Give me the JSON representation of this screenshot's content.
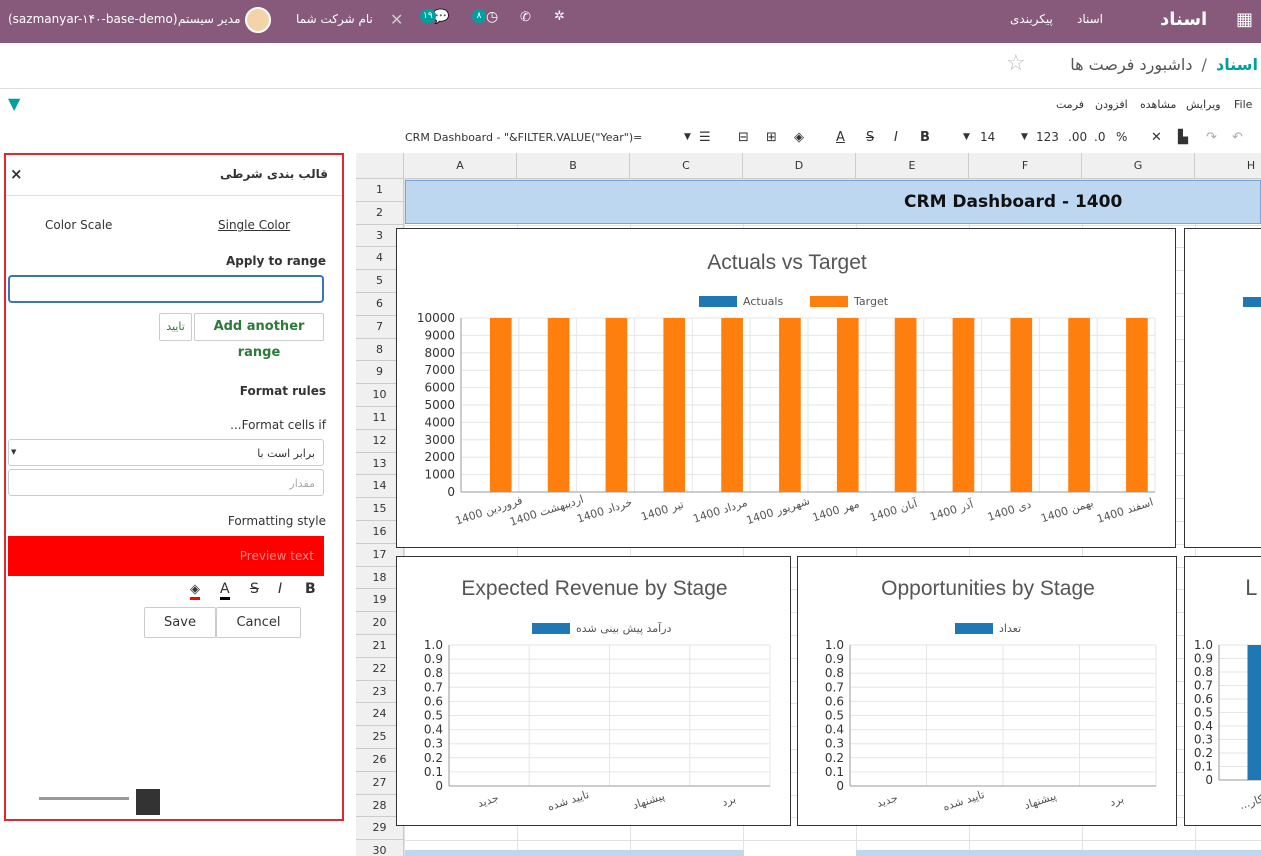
{
  "topbar": {
    "app_name": "اسناد",
    "menu": [
      "اسناد",
      "پیکربندی"
    ],
    "user": "مدیر سیستم",
    "db": "(sazmanyar-۱۴۰-base-demo)",
    "company": "نام شرکت شما",
    "badge_messages": "۱۹",
    "badge_activities": "۸"
  },
  "breadcrumb": {
    "root": "اسناد",
    "separator": "/",
    "current": "داشبورد فرصت ها"
  },
  "menubar": {
    "file": "File",
    "edit": "ویرایش",
    "view": "مشاهده",
    "insert": "افزودن",
    "format": "فرمت"
  },
  "toolbar": {
    "formula": "CRM Dashboard - \"&FILTER.VALUE(\"Year\")=",
    "font_size": "14",
    "num_format": "123",
    "dec_more": ".00",
    "dec_less": ".0",
    "percent": "%"
  },
  "panel": {
    "title": "قالب بندی شرطی",
    "close": "×",
    "tab_single": "Single Color",
    "tab_scale": "Color Scale",
    "apply_range_label": "Apply to range",
    "range_value": "",
    "add_range": "Add another range",
    "confirm": "تایید",
    "format_rules": "Format rules",
    "format_cells_if": "...Format cells if",
    "condition_value": "برابر است با",
    "value_placeholder": "مقدار",
    "formatting_style": "Formatting style",
    "preview_text": "Preview text",
    "save": "Save",
    "cancel": "Cancel",
    "preview_color": "#ff0000"
  },
  "sheet": {
    "columns": [
      "A",
      "B",
      "C",
      "D",
      "E",
      "F",
      "G",
      "H"
    ],
    "rows": [
      "1",
      "2",
      "3",
      "4",
      "5",
      "6",
      "7",
      "8",
      "9",
      "10",
      "11",
      "12",
      "13",
      "14",
      "15",
      "16",
      "17",
      "18",
      "19",
      "20",
      "21",
      "22",
      "23",
      "24",
      "25",
      "26",
      "27",
      "28",
      "29",
      "30"
    ],
    "banner_title": "CRM Dashboard - 1400",
    "banner_color": "#bdd7f1"
  },
  "chart_data": [
    {
      "type": "bar",
      "title": "Actuals vs Target",
      "categories": [
        "فروردین 1400",
        "اردیبهشت 1400",
        "خرداد 1400",
        "تیر 1400",
        "مرداد 1400",
        "شهریور 1400",
        "مهر 1400",
        "آبان 1400",
        "آذر 1400",
        "دی 1400",
        "بهمن 1400",
        "اسفند 1400"
      ],
      "series": [
        {
          "name": "Actuals",
          "color": "#1f77b4",
          "values": [
            0,
            0,
            0,
            0,
            0,
            0,
            0,
            0,
            0,
            0,
            0,
            0
          ]
        },
        {
          "name": "Target",
          "color": "#ff7f0e",
          "values": [
            10000,
            10000,
            10000,
            10000,
            10000,
            10000,
            10000,
            10000,
            10000,
            10000,
            10000,
            10000
          ]
        }
      ],
      "y_ticks": [
        "0",
        "1000",
        "2000",
        "3000",
        "4000",
        "5000",
        "6000",
        "7000",
        "8000",
        "9000",
        "10000"
      ],
      "ylim": [
        0,
        10000
      ],
      "legend": "top",
      "grid": true
    },
    {
      "type": "bar",
      "title": "Expected Revenue by Stage",
      "categories": [
        "جدید",
        "تایید شده",
        "پیشنهاد",
        "برد"
      ],
      "series": [
        {
          "name": "درآمد پیش بینی شده",
          "color": "#1f77b4",
          "values": [
            0,
            0,
            0,
            0
          ]
        }
      ],
      "y_ticks": [
        "0",
        "0.1",
        "0.2",
        "0.3",
        "0.4",
        "0.5",
        "0.6",
        "0.7",
        "0.8",
        "0.9",
        "1.0"
      ],
      "ylim": [
        0,
        1
      ],
      "legend": "top",
      "grid": true
    },
    {
      "type": "bar",
      "title": "Opportunities by Stage",
      "categories": [
        "جدید",
        "تایید شده",
        "پیشنهاد",
        "برد"
      ],
      "series": [
        {
          "name": "تعداد",
          "color": "#1f77b4",
          "values": [
            0,
            0,
            0,
            0
          ]
        }
      ],
      "y_ticks": [
        "0",
        "0.1",
        "0.2",
        "0.3",
        "0.4",
        "0.5",
        "0.6",
        "0.7",
        "0.8",
        "0.9",
        "1.0"
      ],
      "ylim": [
        0,
        1
      ],
      "legend": "top",
      "grid": true
    },
    {
      "type": "bar",
      "title": "L",
      "categories": [
        "...اهکار"
      ],
      "series": [
        {
          "name": "",
          "color": "#1f77b4",
          "values": [
            1
          ]
        }
      ],
      "y_ticks": [
        "0",
        "0.1",
        "0.2",
        "0.3",
        "0.4",
        "0.5",
        "0.6",
        "0.7",
        "0.8",
        "0.9",
        "1.0"
      ],
      "ylim": [
        0,
        1
      ],
      "legend": "top",
      "grid": true
    }
  ]
}
